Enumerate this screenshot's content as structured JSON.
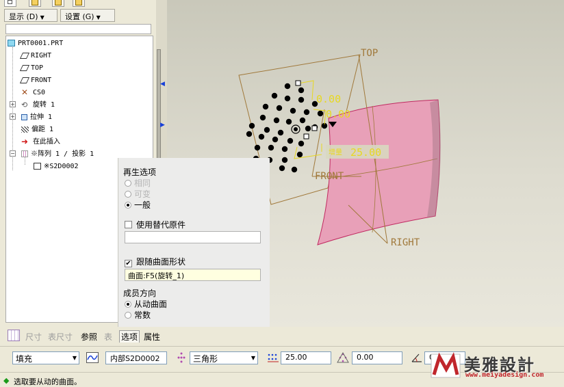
{
  "menubar": {
    "display": "显示 (D)",
    "settings": "设置 (G)"
  },
  "tree": {
    "root": "PRT0001.PRT",
    "items": [
      {
        "label": "RIGHT",
        "icon": "datum-plane-icon"
      },
      {
        "label": "TOP",
        "icon": "datum-plane-icon"
      },
      {
        "label": "FRONT",
        "icon": "datum-plane-icon"
      },
      {
        "label": "CS0",
        "icon": "coordinate-system-icon"
      },
      {
        "label": "旋转 1",
        "icon": "revolve-icon"
      },
      {
        "label": "拉伸 1",
        "icon": "extrude-icon"
      },
      {
        "label": "偏距 1",
        "icon": "offset-icon"
      },
      {
        "label": "在此插入",
        "icon": "insert-here-arrow-icon"
      },
      {
        "label": "※阵列 1 / 投影 1",
        "icon": "pattern-icon"
      },
      {
        "label": "※S2D0002",
        "icon": "sketch-icon"
      }
    ]
  },
  "viewport": {
    "plane_top": "TOP",
    "plane_front": "FRONT",
    "plane_right": "RIGHT",
    "dim1": "0.00",
    "dim2": "0.00",
    "dim3": "25.00",
    "dim3_prefix": "增量"
  },
  "options_panel": {
    "regen_title": "再生选项",
    "regen_same": "相同",
    "regen_variable": "可变",
    "regen_general": "一般",
    "use_alt_original": "使用替代原件",
    "follow_surface_shape": "跟随曲面形状",
    "surface_ref": "曲面:F5(旋转_1)",
    "member_dir_title": "成员方向",
    "dir_follow_surface": "从动曲面",
    "dir_constant": "常数"
  },
  "tabs": {
    "dimensions": "尺寸",
    "table_dims": "表尺寸",
    "references": "参照",
    "table": "表",
    "options": "选项",
    "properties": "属性"
  },
  "dashboard": {
    "pattern_type": "填充",
    "sketch_ref": "内部S2D0002",
    "grid_shape": "三角形",
    "spacing": "25.00",
    "border_offset": "0.00",
    "rotation": "0.00"
  },
  "status": {
    "message": "选取要从动的曲面。"
  },
  "watermark": {
    "title": "美雅設計",
    "url": "www.meiyadesign.com"
  },
  "colors": {
    "surface": "#e8a0b8",
    "datum_plane": "#a0783a",
    "dim_yellow": "#e8d820",
    "accent_blue": "#1840d8"
  }
}
